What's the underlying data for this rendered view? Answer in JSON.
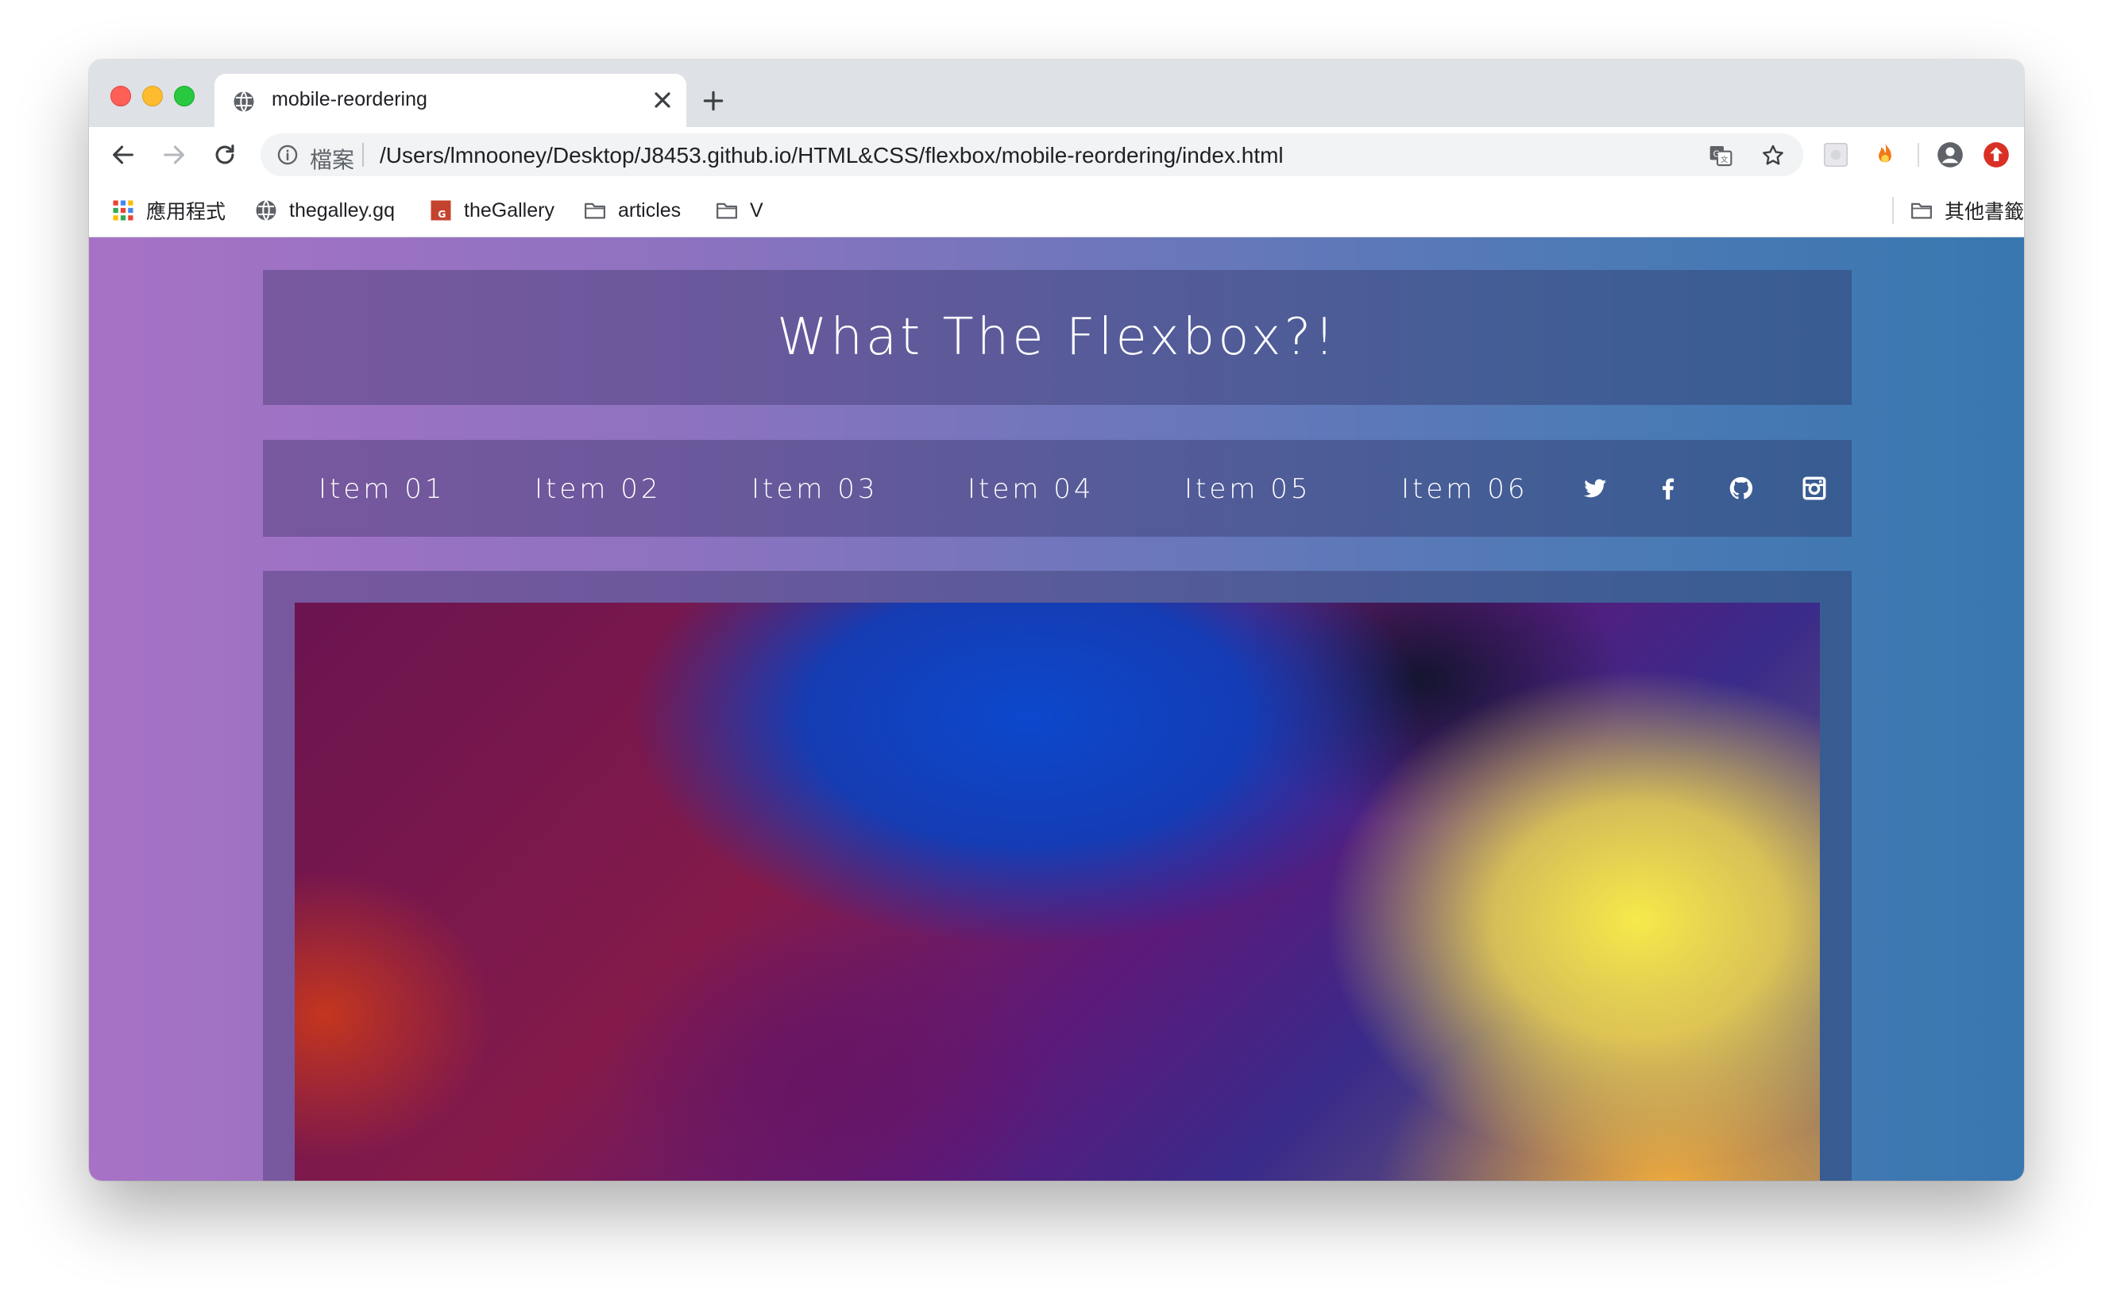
{
  "browser": {
    "tab": {
      "title": "mobile-reordering"
    },
    "omnibox": {
      "scheme_label": "檔案",
      "url": "/Users/lmnooney/Desktop/J8453.github.io/HTML&CSS/flexbox/mobile-reordering/index.html"
    },
    "bookmarks": {
      "items": [
        {
          "label": "應用程式",
          "icon": "apps-grid-icon"
        },
        {
          "label": "thegalley.gq",
          "icon": "globe-icon"
        },
        {
          "label": "theGallery",
          "icon": "gallery-favicon"
        },
        {
          "label": "articles",
          "icon": "folder-icon"
        },
        {
          "label": "V",
          "icon": "folder-icon"
        }
      ],
      "other": {
        "label": "其他書籤",
        "icon": "folder-icon"
      }
    }
  },
  "page": {
    "title": "What The Flexbox?!",
    "nav": {
      "items": [
        "Item 01",
        "Item 02",
        "Item 03",
        "Item 04",
        "Item 05",
        "Item 06"
      ],
      "social": [
        "twitter-icon",
        "facebook-icon",
        "github-icon",
        "instagram-icon"
      ]
    }
  },
  "colors": {
    "gradient_start": "#a772c6",
    "gradient_end": "#3877b0",
    "panel": "rgba(38,35,82,0.32)"
  }
}
